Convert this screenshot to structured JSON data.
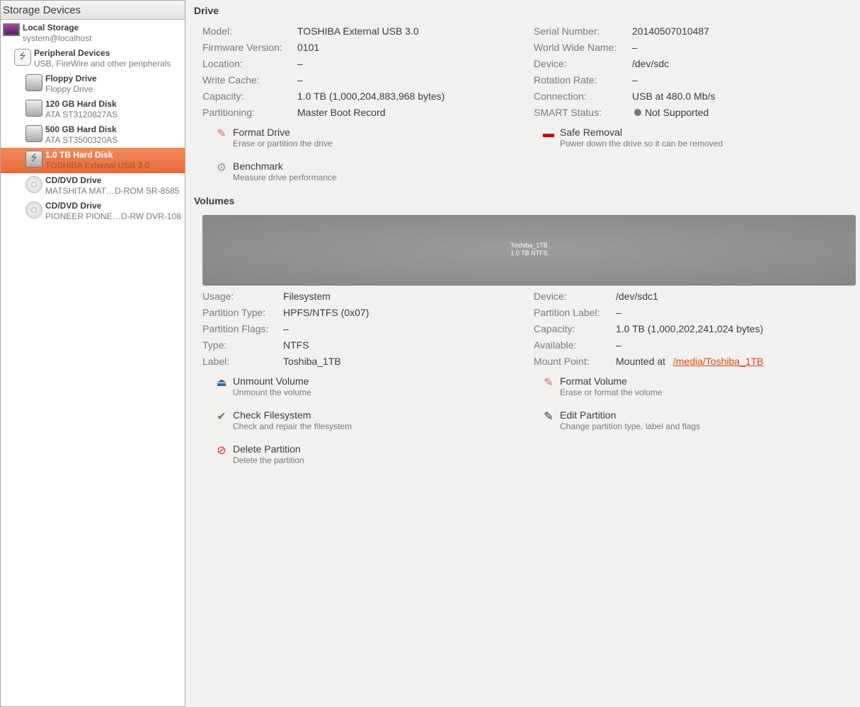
{
  "sidebar": {
    "header": "Storage Devices",
    "items": [
      {
        "title": "Local Storage",
        "subtitle": "system@localhost",
        "icon": "computer-icon"
      },
      {
        "title": "Peripheral Devices",
        "subtitle": "USB, FireWire and other peripherals",
        "icon": "usb-icon"
      },
      {
        "title": "Floppy Drive",
        "subtitle": "Floppy Drive",
        "icon": "floppy-icon"
      },
      {
        "title": "120 GB Hard Disk",
        "subtitle": "ATA ST3120827AS",
        "icon": "harddisk-icon"
      },
      {
        "title": "500 GB Hard Disk",
        "subtitle": "ATA ST3500320AS",
        "icon": "harddisk-icon"
      },
      {
        "title": "1.0 TB Hard Disk",
        "subtitle": "TOSHIBA External USB 3.0",
        "icon": "usb-harddisk-icon",
        "selected": true
      },
      {
        "title": "CD/DVD Drive",
        "subtitle": "MATSHITA MAT…D-ROM SR-8585",
        "icon": "optical-disc-icon"
      },
      {
        "title": "CD/DVD Drive",
        "subtitle": "PIONEER PIONE…D-RW  DVR-108",
        "icon": "optical-disc-icon"
      }
    ]
  },
  "drive": {
    "title": "Drive",
    "left": [
      [
        "Model:",
        "TOSHIBA External USB 3.0"
      ],
      [
        "Firmware Version:",
        "0101"
      ],
      [
        "Location:",
        "–"
      ],
      [
        "Write Cache:",
        "–"
      ],
      [
        "Capacity:",
        "1.0 TB (1,000,204,883,968 bytes)"
      ],
      [
        "Partitioning:",
        "Master Boot Record"
      ]
    ],
    "right": [
      [
        "Serial Number:",
        "20140507010487"
      ],
      [
        "World Wide Name:",
        "–"
      ],
      [
        "Device:",
        "/dev/sdc"
      ],
      [
        "Rotation Rate:",
        "–"
      ],
      [
        "Connection:",
        "USB at 480.0 Mb/s"
      ],
      [
        "SMART Status:",
        "Not Supported"
      ]
    ],
    "actions": [
      {
        "title": "Format Drive",
        "sub": "Erase or partition the drive"
      },
      {
        "title": "Safe Removal",
        "sub": "Power down the drive so it can be removed"
      },
      {
        "title": "Benchmark",
        "sub": "Measure drive performance"
      }
    ]
  },
  "volumes": {
    "title": "Volumes",
    "bar": {
      "name": "Toshiba_1TB",
      "desc": "1.0 TB NTFS"
    },
    "left": [
      [
        "Usage:",
        "Filesystem"
      ],
      [
        "Partition Type:",
        "HPFS/NTFS (0x07)"
      ],
      [
        "Partition Flags:",
        "–"
      ],
      [
        "Type:",
        "NTFS"
      ],
      [
        "Label:",
        "Toshiba_1TB"
      ]
    ],
    "right": [
      [
        "Device:",
        "/dev/sdc1"
      ],
      [
        "Partition Label:",
        "–"
      ],
      [
        "Capacity:",
        "1.0 TB (1,000,202,241,024 bytes)"
      ],
      [
        "Available:",
        "–"
      ],
      [
        "Mount Point:",
        "Mounted at "
      ]
    ],
    "mount_link": "/media/Toshiba_1TB",
    "actions": [
      {
        "title": "Unmount Volume",
        "sub": "Unmount the volume"
      },
      {
        "title": "Format Volume",
        "sub": "Erase or format the volume"
      },
      {
        "title": "Check Filesystem",
        "sub": "Check and repair the filesystem"
      },
      {
        "title": "Edit Partition",
        "sub": "Change partition type, label and flags"
      },
      {
        "title": "Delete Partition",
        "sub": "Delete the partition"
      }
    ]
  },
  "colors": {
    "selection": "#e8693a",
    "link": "#dd4814"
  }
}
